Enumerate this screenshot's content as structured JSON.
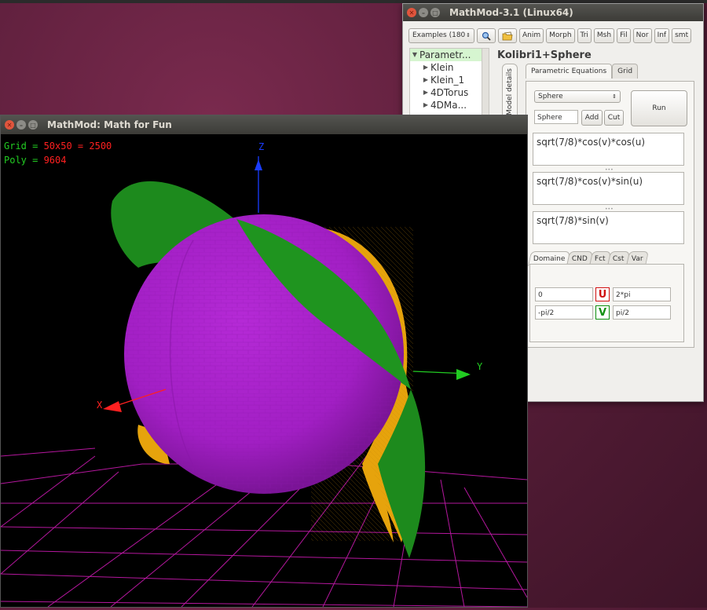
{
  "main_window": {
    "title": "MathMod-3.1 (Linux64)",
    "toolbar": {
      "examples": "Examples (180",
      "buttons": [
        "Anim",
        "Morph",
        "Tri",
        "Msh",
        "Fil",
        "Nor",
        "Inf",
        "smt"
      ]
    },
    "tree": {
      "root": "Parametr...",
      "items": [
        "Klein",
        "Klein_1",
        "4DTorus",
        "4DMa..."
      ]
    },
    "model_title": "Kolibri1+Sphere",
    "side_tab": "Model details",
    "tabs": [
      "Parametric Equations",
      "Grid"
    ],
    "component_select": "Sphere",
    "run_label": "Run",
    "name_field": "Sphere",
    "add_label": "Add",
    "cut_label": "Cut",
    "equations": [
      "sqrt(7/8)*cos(v)*cos(u)",
      "sqrt(7/8)*cos(v)*sin(u)",
      "sqrt(7/8)*sin(v)"
    ],
    "domain_tabs": [
      "Domaine",
      "CND",
      "Fct",
      "Cst",
      "Var"
    ],
    "domain": {
      "u_min": "0",
      "u_label": "U",
      "u_max": "2*pi",
      "v_min": "-pi/2",
      "v_label": "V",
      "v_max": "pi/2"
    }
  },
  "viewer": {
    "title": "MathMod: Math for Fun",
    "grid_label": "Grid = ",
    "grid_value": "50x50 = 2500",
    "poly_label": "Poly = ",
    "poly_value": "9604",
    "axis_x": "X",
    "axis_y": "Y",
    "axis_z": "Z"
  },
  "colors": {
    "sphere": "#a21fc4",
    "surface_green": "#1d8a1d",
    "surface_orange": "#e6a30c",
    "floor_grid": "#b5179e",
    "overlay_green": "#22cc22",
    "overlay_red": "#ff2020"
  }
}
